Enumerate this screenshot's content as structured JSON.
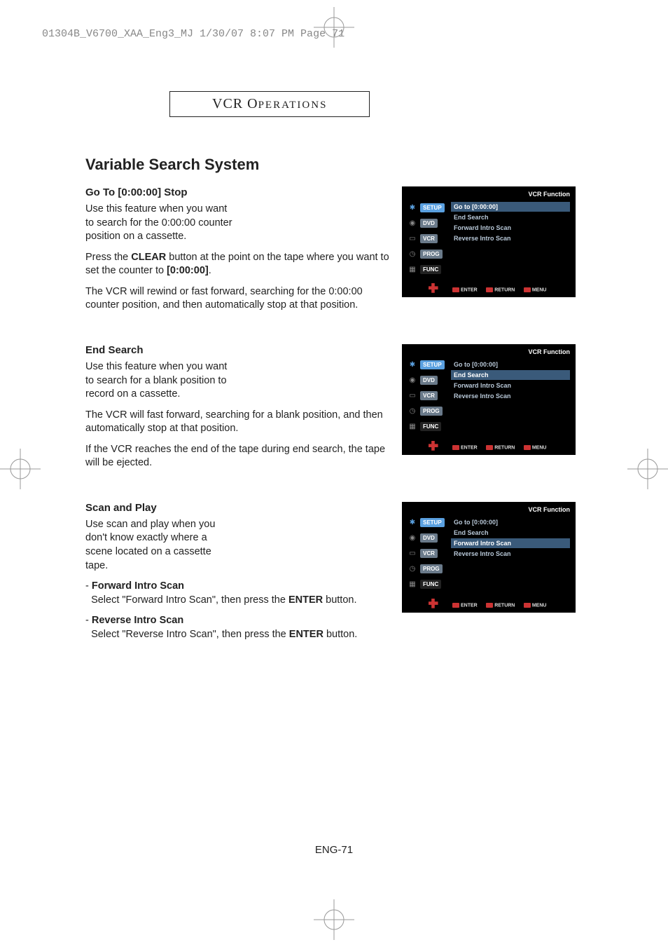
{
  "header_line": "01304B_V6700_XAA_Eng3_MJ  1/30/07  8:07 PM  Page 71",
  "chapter": {
    "line1_big": "VCR O",
    "line1_small": "PERATIONS"
  },
  "page_title": "Variable Search System",
  "section_goto": {
    "heading": "Go To [0:00:00] Stop",
    "p1": "Use this feature when you want to search for the 0:00:00 counter position on a cassette.",
    "p2a": "Press the ",
    "p2b": "CLEAR",
    "p2c": " button at the point on the tape where you want to set the counter to ",
    "p2d": "[0:00:00]",
    "p2e": ".",
    "p3": "The VCR will rewind or fast forward, searching for the 0:00:00 counter position, and then automatically stop at that position."
  },
  "section_end": {
    "heading": "End Search",
    "p1": "Use this feature when you want to search for a blank position to record on a cassette.",
    "p2": "The VCR will fast forward, searching for a blank position, and then automatically stop at that position.",
    "p3": "If the VCR reaches the end of the tape during end search, the tape will be ejected."
  },
  "section_scan": {
    "heading": "Scan and Play",
    "p1": "Use scan and play when you don't know exactly where a scene located on a cassette tape.",
    "fwd_label": "Forward Intro Scan",
    "fwd_text_a": "Select \"Forward Intro Scan\", then press the ",
    "fwd_text_b": "ENTER",
    "fwd_text_c": " button.",
    "rev_label": "Reverse Intro Scan",
    "rev_text_a": "Select \"Reverse Intro Scan\", then press the ",
    "rev_text_b": "ENTER",
    "rev_text_c": " button."
  },
  "osd": {
    "window_title": "VCR Function",
    "sidebar": [
      "SETUP",
      "DVD",
      "VCR",
      "PROG",
      "FUNC"
    ],
    "menu": [
      "Go to [0:00:00]",
      "End Search",
      "Forward Intro Scan",
      "Reverse Intro Scan"
    ],
    "footer": [
      "ENTER",
      "RETURN",
      "MENU"
    ]
  },
  "page_number": "ENG-71"
}
